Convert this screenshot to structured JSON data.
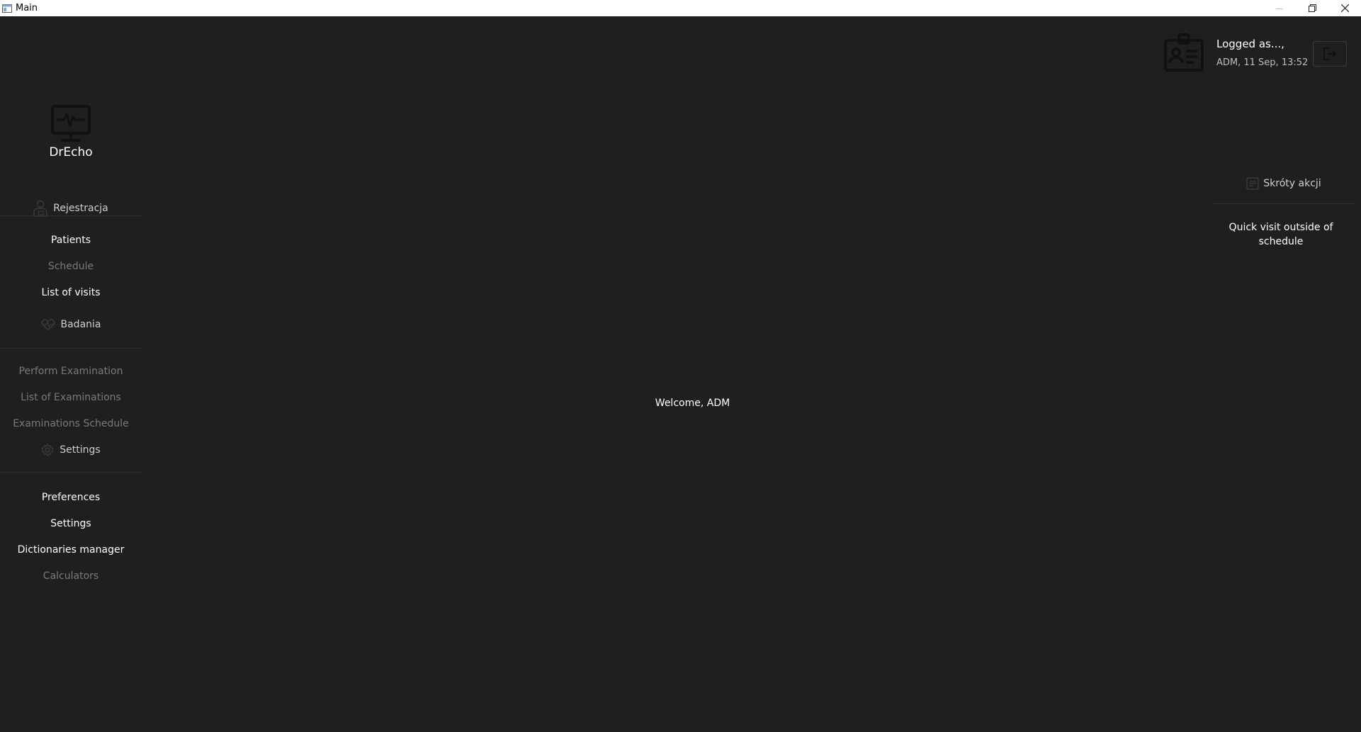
{
  "window": {
    "title": "Main"
  },
  "sidebar": {
    "brand": "DrEcho",
    "sections": [
      {
        "header": "Rejestracja",
        "items": [
          {
            "label": "Patients",
            "enabled": true
          },
          {
            "label": "Schedule",
            "enabled": false
          },
          {
            "label": "List of visits",
            "enabled": true
          }
        ]
      },
      {
        "header": "Badania",
        "items": [
          {
            "label": "Perform Examination",
            "enabled": false
          },
          {
            "label": "List of Examinations",
            "enabled": false
          },
          {
            "label": "Examinations Schedule",
            "enabled": false
          }
        ]
      },
      {
        "header": "Settings",
        "items": [
          {
            "label": "Preferences",
            "enabled": true
          },
          {
            "label": "Settings",
            "enabled": true
          },
          {
            "label": "Dictionaries manager",
            "enabled": true
          },
          {
            "label": "Calculators",
            "enabled": false
          }
        ]
      }
    ]
  },
  "main": {
    "welcome": "Welcome, ADM"
  },
  "user": {
    "logged_as": "Logged as...,",
    "session": "ADM, 11 Sep, 13:52"
  },
  "shortcuts": {
    "header": "Skróty akcji",
    "items": [
      "Quick visit outside of schedule"
    ]
  },
  "colors": {
    "background": "#1f1f21",
    "text": "#ffffff",
    "disabled_text": "#7a7a7c",
    "divider": "#2e2e31"
  }
}
